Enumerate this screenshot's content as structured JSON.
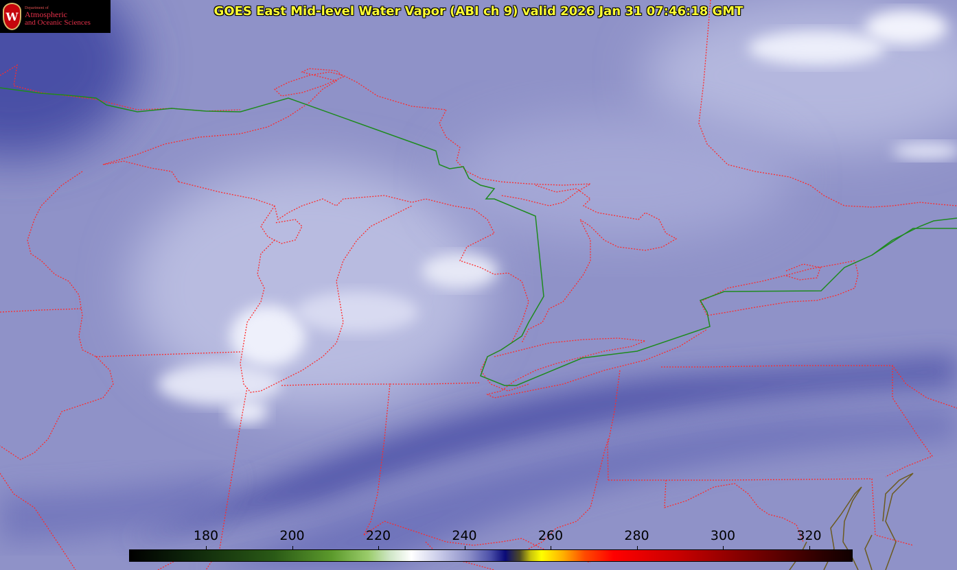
{
  "title": "GOES East Mid-level Water Vapor (ABI ch 9)  valid 2026 Jan 31 07:46:18 GMT",
  "logo": {
    "department": "Department of",
    "line1": "Atmospheric",
    "line2": "and Oceanic Sciences",
    "crest_letter": "W"
  },
  "colorbar": {
    "units_min": 180,
    "ticks": [
      "180",
      "200",
      "220",
      "240",
      "260",
      "280",
      "300",
      "320"
    ]
  },
  "colors": {
    "background": "#8c8fc6",
    "state_borders": "#ff2a2a",
    "international_border": "#1e8a1e",
    "coastline": "#6b5a1e",
    "title": "#ffff33"
  }
}
